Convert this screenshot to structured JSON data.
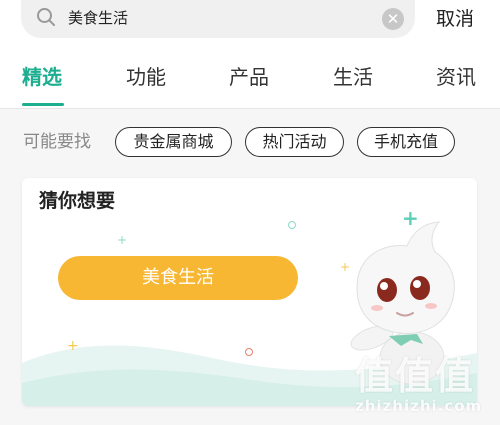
{
  "search": {
    "query": "美食生活",
    "cancel_label": "取消"
  },
  "tabs": [
    {
      "label": "精选",
      "active": true
    },
    {
      "label": "功能",
      "active": false
    },
    {
      "label": "产品",
      "active": false
    },
    {
      "label": "生活",
      "active": false
    },
    {
      "label": "资讯",
      "active": false
    }
  ],
  "suggestions": {
    "label": "可能要找",
    "chips": [
      "贵金属商城",
      "热门活动",
      "手机充值"
    ]
  },
  "card": {
    "title": "猜你想要",
    "cta_label": "美食生活"
  },
  "watermark": {
    "glyphs": "值值值",
    "url": "zhizhizhi.com"
  },
  "colors": {
    "accent": "#1cae8f",
    "cta": "#f7b733"
  }
}
